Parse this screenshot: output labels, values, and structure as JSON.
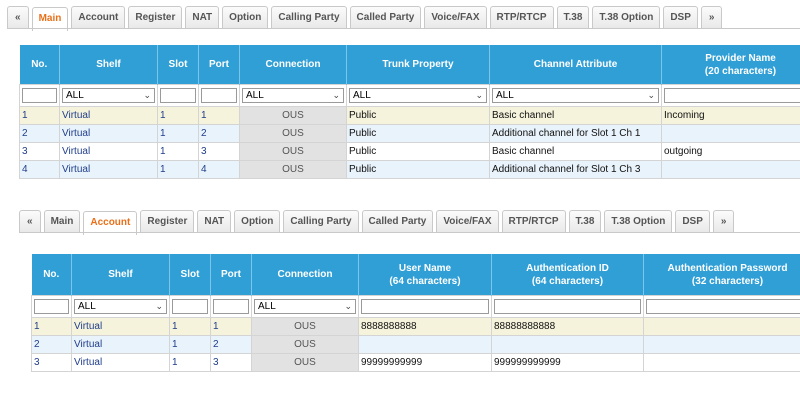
{
  "panel_main": {
    "tabs": [
      "«",
      "Main",
      "Account",
      "Register",
      "NAT",
      "Option",
      "Calling Party",
      "Called Party",
      "Voice/FAX",
      "RTP/RTCP",
      "T.38",
      "T.38 Option",
      "DSP",
      "»"
    ],
    "columns": [
      "No.",
      "Shelf",
      "Slot",
      "Port",
      "Connection",
      "Trunk Property",
      "Channel Attribute",
      "Provider Name\n(20 characters)"
    ],
    "filters": {
      "shelf": "ALL",
      "connection": "ALL",
      "trunk_property": "ALL",
      "channel_attribute": "ALL"
    },
    "rows": [
      {
        "no": "1",
        "shelf": "Virtual",
        "slot": "1",
        "port": "1",
        "connection": "OUS",
        "trunk_property": "Public",
        "channel_attribute": "Basic channel",
        "provider_name": "Incoming"
      },
      {
        "no": "2",
        "shelf": "Virtual",
        "slot": "1",
        "port": "2",
        "connection": "OUS",
        "trunk_property": "Public",
        "channel_attribute": "Additional channel for Slot 1 Ch 1",
        "provider_name": ""
      },
      {
        "no": "3",
        "shelf": "Virtual",
        "slot": "1",
        "port": "3",
        "connection": "OUS",
        "trunk_property": "Public",
        "channel_attribute": "Basic channel",
        "provider_name": "outgoing"
      },
      {
        "no": "4",
        "shelf": "Virtual",
        "slot": "1",
        "port": "4",
        "connection": "OUS",
        "trunk_property": "Public",
        "channel_attribute": "Additional channel for Slot 1 Ch 3",
        "provider_name": ""
      }
    ]
  },
  "panel_account": {
    "tabs": [
      "«",
      "Main",
      "Account",
      "Register",
      "NAT",
      "Option",
      "Calling Party",
      "Called Party",
      "Voice/FAX",
      "RTP/RTCP",
      "T.38",
      "T.38 Option",
      "DSP",
      "»"
    ],
    "columns": [
      "No.",
      "Shelf",
      "Slot",
      "Port",
      "Connection",
      "User Name\n(64 characters)",
      "Authentication ID\n(64 characters)",
      "Authentication Password\n(32 characters)"
    ],
    "filters": {
      "shelf": "ALL",
      "connection": "ALL"
    },
    "rows": [
      {
        "no": "1",
        "shelf": "Virtual",
        "slot": "1",
        "port": "1",
        "connection": "OUS",
        "user_name": "8888888888",
        "auth_id": "88888888888",
        "auth_password": ""
      },
      {
        "no": "2",
        "shelf": "Virtual",
        "slot": "1",
        "port": "2",
        "connection": "OUS",
        "user_name": "",
        "auth_id": "",
        "auth_password": ""
      },
      {
        "no": "3",
        "shelf": "Virtual",
        "slot": "1",
        "port": "3",
        "connection": "OUS",
        "user_name": "99999999999",
        "auth_id": "999999999999",
        "auth_password": ""
      }
    ]
  },
  "colors": {
    "header_blue": "#2f9fd6",
    "active_tab": "#e8701a",
    "row_highlight": "#f5f3dc",
    "row_blue": "#e9f3fb",
    "connection_cell": "#e2e2e2"
  }
}
